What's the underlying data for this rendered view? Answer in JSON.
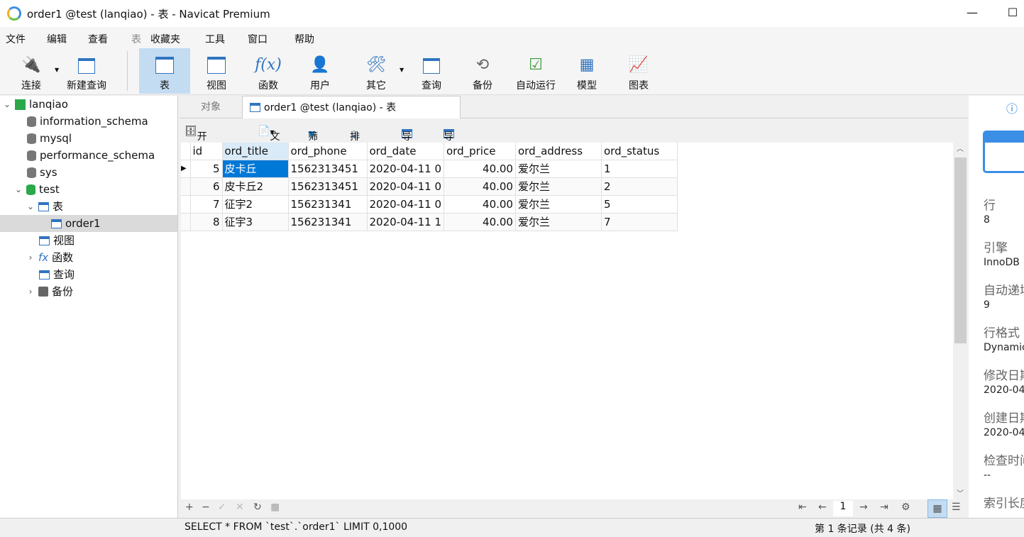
{
  "window": {
    "title": "order1 @test (lanqiao) - 表 - Navicat Premium",
    "minimize": "—",
    "maximize": "☐",
    "close": "✕"
  },
  "menu": [
    "文件",
    "编辑",
    "查看",
    "表",
    "收藏夹",
    "工具",
    "窗口",
    "帮助"
  ],
  "toolbar": [
    {
      "label": "连接",
      "icon": "plug-icon"
    },
    {
      "label": "新建查询",
      "icon": "new-query-icon"
    },
    {
      "label": "表",
      "icon": "table-icon",
      "active": true
    },
    {
      "label": "视图",
      "icon": "view-icon"
    },
    {
      "label": "函数",
      "icon": "function-icon"
    },
    {
      "label": "用户",
      "icon": "user-icon"
    },
    {
      "label": "其它",
      "icon": "tools-icon"
    },
    {
      "label": "查询",
      "icon": "query-icon"
    },
    {
      "label": "备份",
      "icon": "backup-icon"
    },
    {
      "label": "自动运行",
      "icon": "schedule-icon"
    },
    {
      "label": "模型",
      "icon": "model-icon"
    },
    {
      "label": "图表",
      "icon": "chart-icon"
    }
  ],
  "tree": {
    "connection": "lanqiao",
    "databases": [
      "information_schema",
      "mysql",
      "performance_schema",
      "sys",
      "test"
    ],
    "groups": {
      "tables": "表",
      "table_item": "order1",
      "views": "视图",
      "functions": "函数",
      "queries": "查询",
      "backups": "备份"
    }
  },
  "tabs": {
    "objects": "对象",
    "active": "order1 @test (lanqiao) - 表"
  },
  "subtoolbar": {
    "begin_tx": "开始事务",
    "text": "文本",
    "filter": "筛选",
    "sort": "排序",
    "import": "导入",
    "export": "导出"
  },
  "grid": {
    "columns": [
      "id",
      "ord_title",
      "ord_phone",
      "ord_date",
      "ord_price",
      "ord_address",
      "ord_status"
    ],
    "rows": [
      [
        "5",
        "皮卡丘",
        "1562313451",
        "2020-04-11 0",
        "40.00",
        "爱尔兰",
        "1"
      ],
      [
        "6",
        "皮卡丘2",
        "1562313451",
        "2020-04-11 0",
        "40.00",
        "爱尔兰",
        "2"
      ],
      [
        "7",
        "征宇2",
        "156231341",
        "2020-04-11 0",
        "40.00",
        "爱尔兰",
        "5"
      ],
      [
        "8",
        "征宇3",
        "156231341",
        "2020-04-11 1",
        "40.00",
        "爱尔兰",
        "7"
      ]
    ]
  },
  "pager": {
    "page": "1"
  },
  "status": {
    "sql": "SELECT * FROM `test`.`order1` LIMIT 0,1000",
    "records": "第 1 条记录 (共 4 条)"
  },
  "info": [
    {
      "label": "行",
      "value": "8"
    },
    {
      "label": "引擎",
      "value": "InnoDB"
    },
    {
      "label": "自动递增",
      "value": "9"
    },
    {
      "label": "行格式",
      "value": "Dynamic"
    },
    {
      "label": "修改日期",
      "value": "2020-04"
    },
    {
      "label": "创建日期",
      "value": "2020-04"
    },
    {
      "label": "检查时间",
      "value": "--"
    },
    {
      "label": "索引长度",
      "value": ""
    }
  ]
}
